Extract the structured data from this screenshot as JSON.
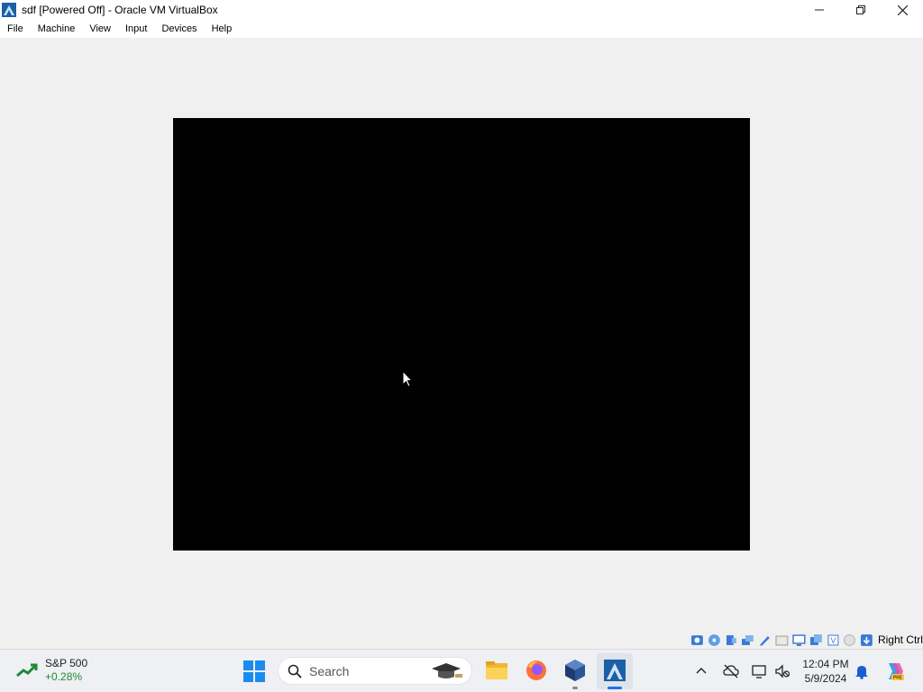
{
  "window": {
    "title": "sdf [Powered Off] - Oracle VM VirtualBox",
    "icon": "virtualbox-vm-icon"
  },
  "menu": {
    "items": [
      {
        "label": "File"
      },
      {
        "label": "Machine"
      },
      {
        "label": "View"
      },
      {
        "label": "Input"
      },
      {
        "label": "Devices"
      },
      {
        "label": "Help"
      }
    ]
  },
  "vm_screen": {
    "state": "powered-off",
    "color": "#000000"
  },
  "statusbar": {
    "icons": [
      "hard-disk-icon",
      "optical-drive-icon",
      "audio-icon",
      "network-icon",
      "usb-icon",
      "shared-folders-icon",
      "display-icon",
      "recording-icon",
      "cpu-icon",
      "mouse-integration-icon",
      "keyboard-icon"
    ],
    "host_key": "Right Ctrl"
  },
  "taskbar": {
    "widget": {
      "name": "S&P 500",
      "change": "+0.28%",
      "change_color": "#1e8a34"
    },
    "search_placeholder": "Search",
    "apps": [
      "file-explorer-icon",
      "firefox-icon",
      "virtualbox-icon",
      "virtualbox-vm-icon"
    ],
    "clock": {
      "time": "12:04 PM",
      "date": "5/9/2024"
    }
  }
}
